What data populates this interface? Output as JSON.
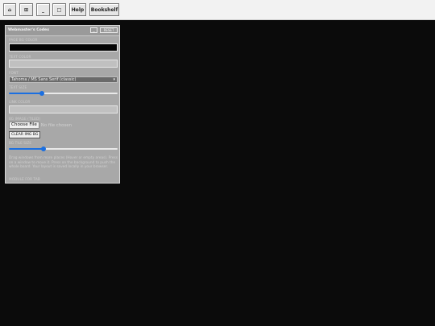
{
  "toolbar": {
    "home_icon": "home-icon",
    "grid_icon": "grid-icon",
    "minimize_glyph": "_",
    "maximize_glyph": "□",
    "help_label": "Help",
    "bookshelf_label": "Bookshelf",
    "home_glyph": "⌂",
    "grid_glyph": "⊞"
  },
  "panel": {
    "title": "Webmaster's Codex",
    "minimize_label": "_",
    "reset_label": "RESET",
    "page_bg_label": "PAGE BG COLOR",
    "page_bg_value": "#000000",
    "text_color_label": "TEXT COLOR",
    "font_label": "FONT",
    "font_selected": "Tahoma / MS Sans Serif (classic)",
    "text_size_label": "TEXT SIZE",
    "text_size_fraction": 0.3,
    "link_color_label": "LINK COLOR",
    "bg_image_label": "BG IMAGE (TILED)",
    "choose_file_label": "Choose File",
    "no_file_label": "No file chosen",
    "clear_img_label": "CLEAR IMG BG",
    "bg_tile_size_label": "BG TILE SIZE",
    "bg_tile_fraction": 0.32,
    "help_text": "Drag windows from more places (Hover or empty areas). Press on a window to move it. Press on the background to push the whole board. Your layout is saved locally in your browser.",
    "bottom_label": "MODULE FOR TAB"
  },
  "colors": {
    "page_bg": "#0b0b0b",
    "panel_bg": "#a8a8a8",
    "accent": "#1b6fe0"
  }
}
